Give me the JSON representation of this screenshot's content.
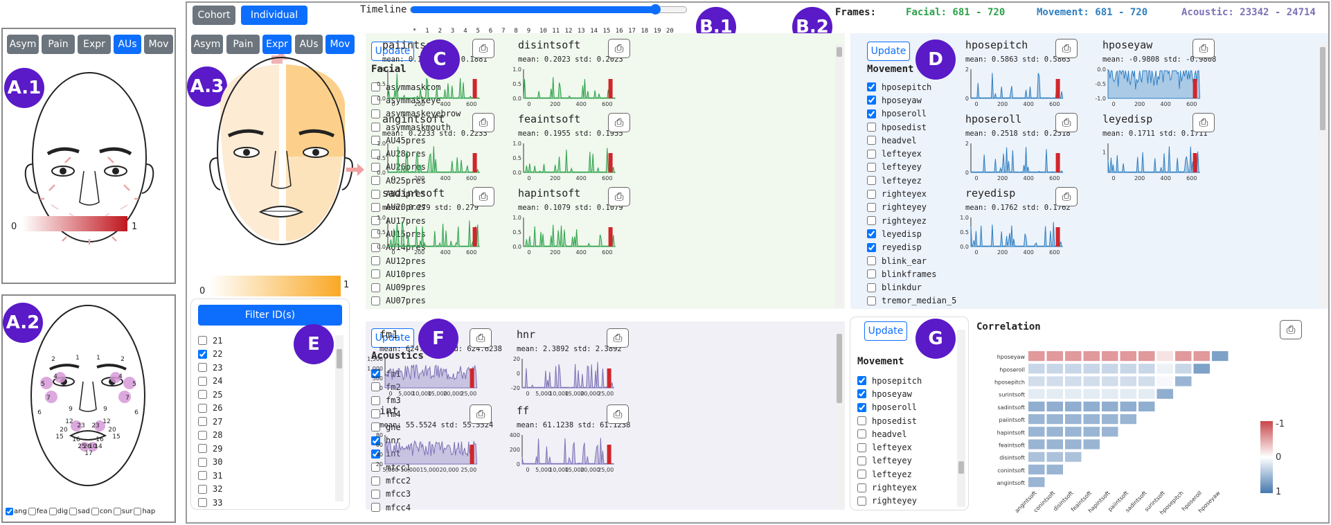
{
  "left": {
    "tabs": [
      "Asym",
      "Pain",
      "Expr",
      "AUs",
      "Mov"
    ],
    "active": "AUs",
    "legend_min": "0",
    "legend_max": "1",
    "badge_a1": "A.1",
    "badge_a2": "A.2",
    "emotions": [
      {
        "label": "ang",
        "checked": true
      },
      {
        "label": "fea",
        "checked": false
      },
      {
        "label": "dig",
        "checked": false
      },
      {
        "label": "sad",
        "checked": false
      },
      {
        "label": "con",
        "checked": false
      },
      {
        "label": "sur",
        "checked": false
      },
      {
        "label": "hap",
        "checked": false
      }
    ],
    "au_labels": [
      "2",
      "1",
      "1",
      "2",
      "4",
      "4",
      "5",
      "5",
      "7",
      "7",
      "6",
      "6",
      "9",
      "9",
      "12",
      "12",
      "20",
      "20",
      "15",
      "15",
      "23",
      "23",
      "16",
      "16",
      "25",
      "26",
      "10",
      "14",
      "17"
    ]
  },
  "top": {
    "cohort": "Cohort",
    "individual": "Individual",
    "timeline_label": "Timeline",
    "timeline_ticks": [
      "*",
      "1",
      "2",
      "3",
      "4",
      "5",
      "6",
      "7",
      "8",
      "9",
      "10",
      "11",
      "12",
      "13",
      "14",
      "15",
      "16",
      "17",
      "18",
      "19",
      "20"
    ],
    "timeline_value": 18,
    "frames_label": "Frames:",
    "facial_frames": "Facial: 681 - 720",
    "movement_frames": "Movement: 681 - 720",
    "acoustic_frames": "Acoustic: 23342 - 24714",
    "colors": {
      "facial": "#2ca24a",
      "movement": "#2f7fc1",
      "acoustic": "#7b71b6"
    },
    "badge_b1": "B.1",
    "badge_b2": "B.2"
  },
  "mid": {
    "tabs": [
      "Asym",
      "Pain",
      "Expr",
      "AUs",
      "Mov"
    ],
    "active": [
      "Expr",
      "Mov"
    ],
    "legend_min": "0",
    "legend_max": "1",
    "badge_a3": "A.3"
  },
  "facial": {
    "update": "Update",
    "title": "Facial",
    "badge": "C",
    "features": [
      {
        "label": "asymmaskcom",
        "checked": false
      },
      {
        "label": "asymmaskeye",
        "checked": false
      },
      {
        "label": "asymmaskeyebrow",
        "checked": false
      },
      {
        "label": "asymmaskmouth",
        "checked": false
      },
      {
        "label": "AU45pres",
        "checked": false
      },
      {
        "label": "AU28pres",
        "checked": false
      },
      {
        "label": "AU26pres",
        "checked": false
      },
      {
        "label": "AU25pres",
        "checked": false
      },
      {
        "label": "AU23pres",
        "checked": false
      },
      {
        "label": "AU20pres",
        "checked": false
      },
      {
        "label": "AU17pres",
        "checked": false
      },
      {
        "label": "AU15pres",
        "checked": false
      },
      {
        "label": "AU14pres",
        "checked": false
      },
      {
        "label": "AU12pres",
        "checked": false
      },
      {
        "label": "AU10pres",
        "checked": false
      },
      {
        "label": "AU09pres",
        "checked": false
      },
      {
        "label": "AU07pres",
        "checked": false
      }
    ],
    "charts": [
      {
        "title": "paiintsoft",
        "stats": "mean: 0.1881  std: 0.1881",
        "yt": [
          "1.0",
          "0.5",
          "0.0"
        ],
        "xt": [
          "0",
          "200",
          "400",
          "600"
        ]
      },
      {
        "title": "disintsoft",
        "stats": "mean: 0.2023  std: 0.2023",
        "yt": [
          "1.0",
          "0.5",
          "0.0"
        ],
        "xt": [
          "0",
          "200",
          "400",
          "600"
        ]
      },
      {
        "title": "angintsoft",
        "stats": "mean: 0.2233  std: 0.2233",
        "yt": [
          "1.0",
          "0.5",
          "0.0"
        ],
        "xt": [
          "0",
          "200",
          "400",
          "600"
        ]
      },
      {
        "title": "feaintsoft",
        "stats": "mean: 0.1955  std: 0.1955",
        "yt": [
          "1.0",
          "0.5",
          "0.0"
        ],
        "xt": [
          "0",
          "200",
          "400",
          "600"
        ]
      },
      {
        "title": "sadintsoft",
        "stats": "mean: 0.279  std: 0.279",
        "yt": [
          "1.0",
          "0.5",
          "0.0"
        ],
        "xt": [
          "0",
          "200",
          "400",
          "600"
        ]
      },
      {
        "title": "hapintsoft",
        "stats": "mean: 0.1079  std: 0.1079",
        "yt": [
          "1.0",
          "0.5",
          "0.0"
        ],
        "xt": [
          "0",
          "200",
          "400",
          "600"
        ]
      }
    ]
  },
  "movement": {
    "update": "Update",
    "title": "Movement",
    "badge": "D",
    "features": [
      {
        "label": "hposepitch",
        "checked": true
      },
      {
        "label": "hposeyaw",
        "checked": true
      },
      {
        "label": "hposeroll",
        "checked": true
      },
      {
        "label": "hposedist",
        "checked": false
      },
      {
        "label": "headvel",
        "checked": false
      },
      {
        "label": "lefteyex",
        "checked": false
      },
      {
        "label": "lefteyey",
        "checked": false
      },
      {
        "label": "lefteyez",
        "checked": false
      },
      {
        "label": "righteyex",
        "checked": false
      },
      {
        "label": "righteyey",
        "checked": false
      },
      {
        "label": "righteyez",
        "checked": false
      },
      {
        "label": "leyedisp",
        "checked": true
      },
      {
        "label": "reyedisp",
        "checked": true
      },
      {
        "label": "blink_ear",
        "checked": false
      },
      {
        "label": "blinkframes",
        "checked": false
      },
      {
        "label": "blinkdur",
        "checked": false
      },
      {
        "label": "tremor_median_5",
        "checked": false
      }
    ],
    "charts": [
      {
        "title": "hposepitch",
        "stats": "mean: 0.5863  std: 0.5863",
        "yt": [
          "2",
          "0"
        ],
        "xt": [
          "0",
          "200",
          "400",
          "600"
        ]
      },
      {
        "title": "hposeyaw",
        "stats": "mean: -0.9808  std: -0.9808",
        "yt": [
          "0.0",
          "-0.5",
          "-1.0"
        ],
        "xt": [
          "0",
          "200",
          "400",
          "600"
        ]
      },
      {
        "title": "hposeroll",
        "stats": "mean: 0.2518  std: 0.2518",
        "yt": [
          "2",
          "0"
        ],
        "xt": [
          "0",
          "200",
          "400",
          "600"
        ]
      },
      {
        "title": "leyedisp",
        "stats": "mean: 0.1711  std: 0.1711",
        "yt": [
          "1"
        ],
        "xt": [
          "0",
          "200",
          "400",
          "600"
        ]
      },
      {
        "title": "reyedisp",
        "stats": "mean: 0.1762  std: 0.1762",
        "yt": [
          "1.0",
          "0.5",
          "0.0"
        ],
        "xt": [
          "0",
          "200",
          "400",
          "600"
        ]
      }
    ]
  },
  "ids": {
    "filter": "Filter ID(s)",
    "badge": "E",
    "items": [
      {
        "label": "21",
        "checked": false
      },
      {
        "label": "22",
        "checked": true
      },
      {
        "label": "23",
        "checked": false
      },
      {
        "label": "24",
        "checked": false
      },
      {
        "label": "25",
        "checked": false
      },
      {
        "label": "26",
        "checked": false
      },
      {
        "label": "27",
        "checked": false
      },
      {
        "label": "28",
        "checked": false
      },
      {
        "label": "29",
        "checked": false
      },
      {
        "label": "30",
        "checked": false
      },
      {
        "label": "31",
        "checked": false
      },
      {
        "label": "32",
        "checked": false
      },
      {
        "label": "33",
        "checked": false
      }
    ]
  },
  "acoustics": {
    "update": "Update",
    "title": "Acoustics",
    "badge": "F",
    "features": [
      {
        "label": "fm1",
        "checked": true
      },
      {
        "label": "fm2",
        "checked": false
      },
      {
        "label": "fm3",
        "checked": false
      },
      {
        "label": "fm4",
        "checked": false
      },
      {
        "label": "gne",
        "checked": false
      },
      {
        "label": "hnr",
        "checked": true
      },
      {
        "label": "int",
        "checked": true
      },
      {
        "label": "mfcc1",
        "checked": false
      },
      {
        "label": "mfcc2",
        "checked": false
      },
      {
        "label": "mfcc3",
        "checked": false
      },
      {
        "label": "mfcc4",
        "checked": false
      }
    ],
    "charts": [
      {
        "title": "fm1",
        "stats": "mean: 624.6238  std: 624.6238",
        "yt": [
          "1,500",
          "1,000",
          "500",
          "0"
        ],
        "xt": [
          "0",
          "5,000",
          "10,000",
          "15,000",
          "20,000",
          "25,00"
        ]
      },
      {
        "title": "hnr",
        "stats": "mean: 2.3892  std: 2.3892",
        "yt": [
          "20",
          "0",
          "-20"
        ],
        "xt": [
          "0",
          "5,000",
          "10,000",
          "15,000",
          "20,000",
          "25,00"
        ]
      },
      {
        "title": "int",
        "stats": "mean: 55.5524  std: 55.5524",
        "yt": [
          "80",
          "60",
          "40",
          "20"
        ],
        "xt": [
          "5,000",
          "10,000",
          "15,000",
          "20,000",
          "25,00"
        ]
      },
      {
        "title": "ff",
        "stats": "mean: 61.1238  std: 61.1238",
        "yt": [
          "400",
          "200",
          "0"
        ],
        "xt": [
          "0",
          "5,000",
          "10,000",
          "15,000",
          "20,000",
          "25,00"
        ]
      }
    ]
  },
  "corr": {
    "update": "Update",
    "title": "Movement",
    "badge": "G",
    "heading": "Correlation",
    "features": [
      {
        "label": "hposepitch",
        "checked": true
      },
      {
        "label": "hposeyaw",
        "checked": true
      },
      {
        "label": "hposeroll",
        "checked": true
      },
      {
        "label": "hposedist",
        "checked": false
      },
      {
        "label": "headvel",
        "checked": false
      },
      {
        "label": "lefteyex",
        "checked": false
      },
      {
        "label": "lefteyey",
        "checked": false
      },
      {
        "label": "lefteyez",
        "checked": false
      },
      {
        "label": "righteyex",
        "checked": false
      },
      {
        "label": "righteyey",
        "checked": false
      }
    ],
    "legend": [
      "-1",
      "0",
      "1"
    ]
  },
  "chart_data": {
    "type": "heatmap",
    "title": "Correlation",
    "rows": [
      "hposeyaw",
      "hposeroll",
      "hposepitch",
      "surintsoft",
      "sadintsoft",
      "paiintsoft",
      "hapintsoft",
      "feaintsoft",
      "disintsoft",
      "conintsoft",
      "angintsoft"
    ],
    "cols": [
      "angintsoft",
      "conintsoft",
      "disintsoft",
      "feaintsoft",
      "hapintsoft",
      "paiintsoft",
      "sadintsoft",
      "surintsoft",
      "hposepitch",
      "hposeroll",
      "hposeyaw"
    ],
    "values": [
      [
        -0.55,
        -0.55,
        -0.55,
        -0.55,
        -0.55,
        -0.55,
        -0.55,
        -0.15,
        -0.55,
        -0.55,
        0.7
      ],
      [
        0.3,
        0.3,
        0.3,
        0.3,
        0.3,
        0.3,
        0.3,
        0.1,
        0.3,
        0.7
      ],
      [
        0.25,
        0.25,
        0.25,
        0.25,
        0.25,
        0.25,
        0.25,
        0.05,
        0.55
      ],
      [
        0.15,
        0.15,
        0.15,
        0.15,
        0.15,
        0.15,
        0.15,
        0.6
      ],
      [
        0.6,
        0.6,
        0.6,
        0.6,
        0.6,
        0.6,
        0.6
      ],
      [
        0.55,
        0.55,
        0.55,
        0.55,
        0.55,
        0.55
      ],
      [
        0.55,
        0.55,
        0.55,
        0.55,
        0.55
      ],
      [
        0.55,
        0.55,
        0.55,
        0.55
      ],
      [
        0.45,
        0.45,
        0.45
      ],
      [
        0.55,
        0.55
      ],
      [
        0.55
      ]
    ],
    "range": [
      -1,
      1
    ]
  }
}
